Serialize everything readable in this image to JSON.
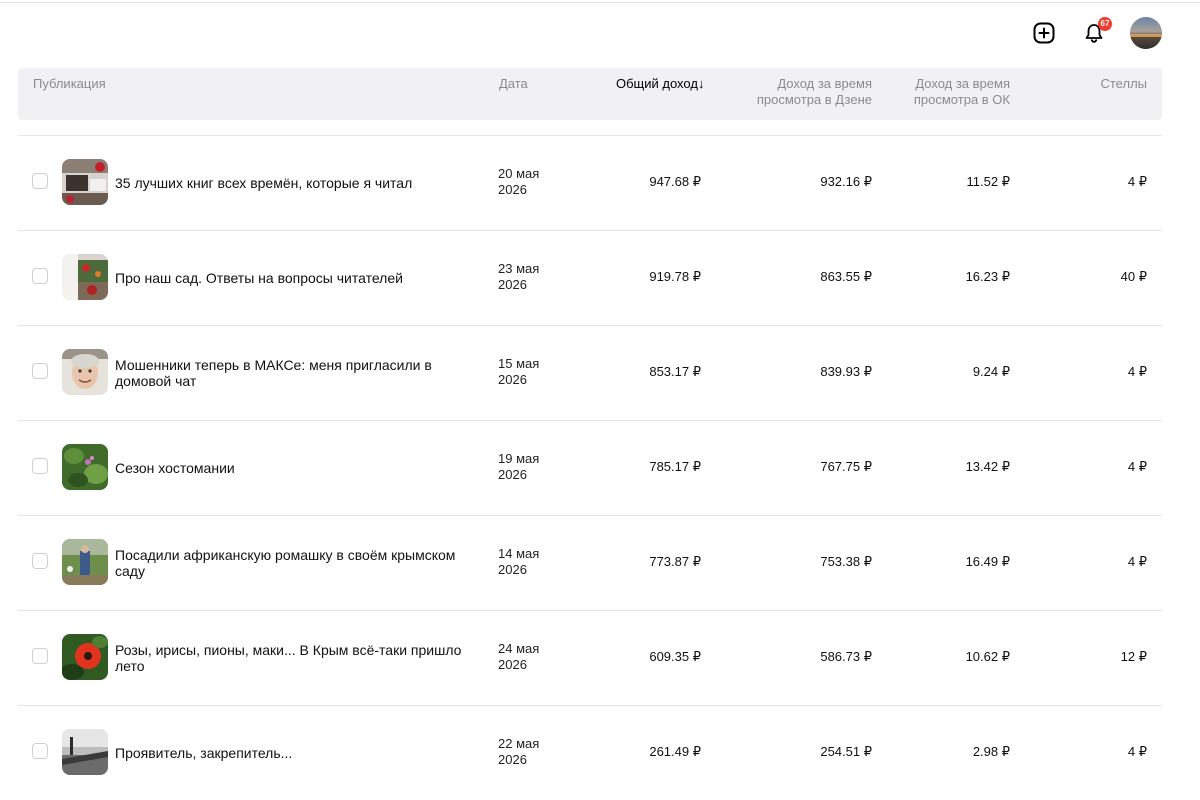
{
  "header": {
    "notifications_count": "67",
    "icons": [
      "add-icon",
      "bell-icon",
      "avatar"
    ]
  },
  "table": {
    "columns": {
      "publication": "Публикация",
      "date": "Дата",
      "total": "Общий доход",
      "total_sort_icon": "↓",
      "dzen_line1": "Доход за время",
      "dzen_line2": "просмотра в Дзене",
      "ok_line1": "Доход за время",
      "ok_line2": "просмотра в ОК",
      "stells": "Стеллы"
    },
    "rows": [
      {
        "title": "35 лучших книг всех времён, которые я читал",
        "date1": "20 мая",
        "date2": "2026",
        "total": "947.68 ₽",
        "dzen": "932.16 ₽",
        "ok": "11.52 ₽",
        "stells": "4 ₽"
      },
      {
        "title": "Про наш сад. Ответы на вопросы читателей",
        "date1": "23 мая",
        "date2": "2026",
        "total": "919.78 ₽",
        "dzen": "863.55 ₽",
        "ok": "16.23 ₽",
        "stells": "40 ₽"
      },
      {
        "title": "Мошенники теперь в МАКСе: меня пригласили в домовой чат",
        "date1": "15 мая",
        "date2": "2026",
        "total": "853.17 ₽",
        "dzen": "839.93 ₽",
        "ok": "9.24 ₽",
        "stells": "4 ₽"
      },
      {
        "title": "Сезон хостомании",
        "date1": "19 мая",
        "date2": "2026",
        "total": "785.17 ₽",
        "dzen": "767.75 ₽",
        "ok": "13.42 ₽",
        "stells": "4 ₽"
      },
      {
        "title": "Посадили африканскую ромашку в своём крымском саду",
        "date1": "14 мая",
        "date2": "2026",
        "total": "773.87 ₽",
        "dzen": "753.38 ₽",
        "ok": "16.49 ₽",
        "stells": "4 ₽"
      },
      {
        "title": "Розы, ирисы, пионы, маки... В Крым всё-таки пришло лето",
        "date1": "24 мая",
        "date2": "2026",
        "total": "609.35 ₽",
        "dzen": "586.73 ₽",
        "ok": "10.62 ₽",
        "stells": "12 ₽"
      },
      {
        "title": "Проявитель, закрепитель...",
        "date1": "22 мая",
        "date2": "2026",
        "total": "261.49 ₽",
        "dzen": "254.51 ₽",
        "ok": "2.98 ₽",
        "stells": "4 ₽"
      }
    ]
  },
  "colors": {
    "header_bg": "#f1f1f3",
    "badge": "#f23c2f",
    "muted_text": "#8a8a90"
  }
}
